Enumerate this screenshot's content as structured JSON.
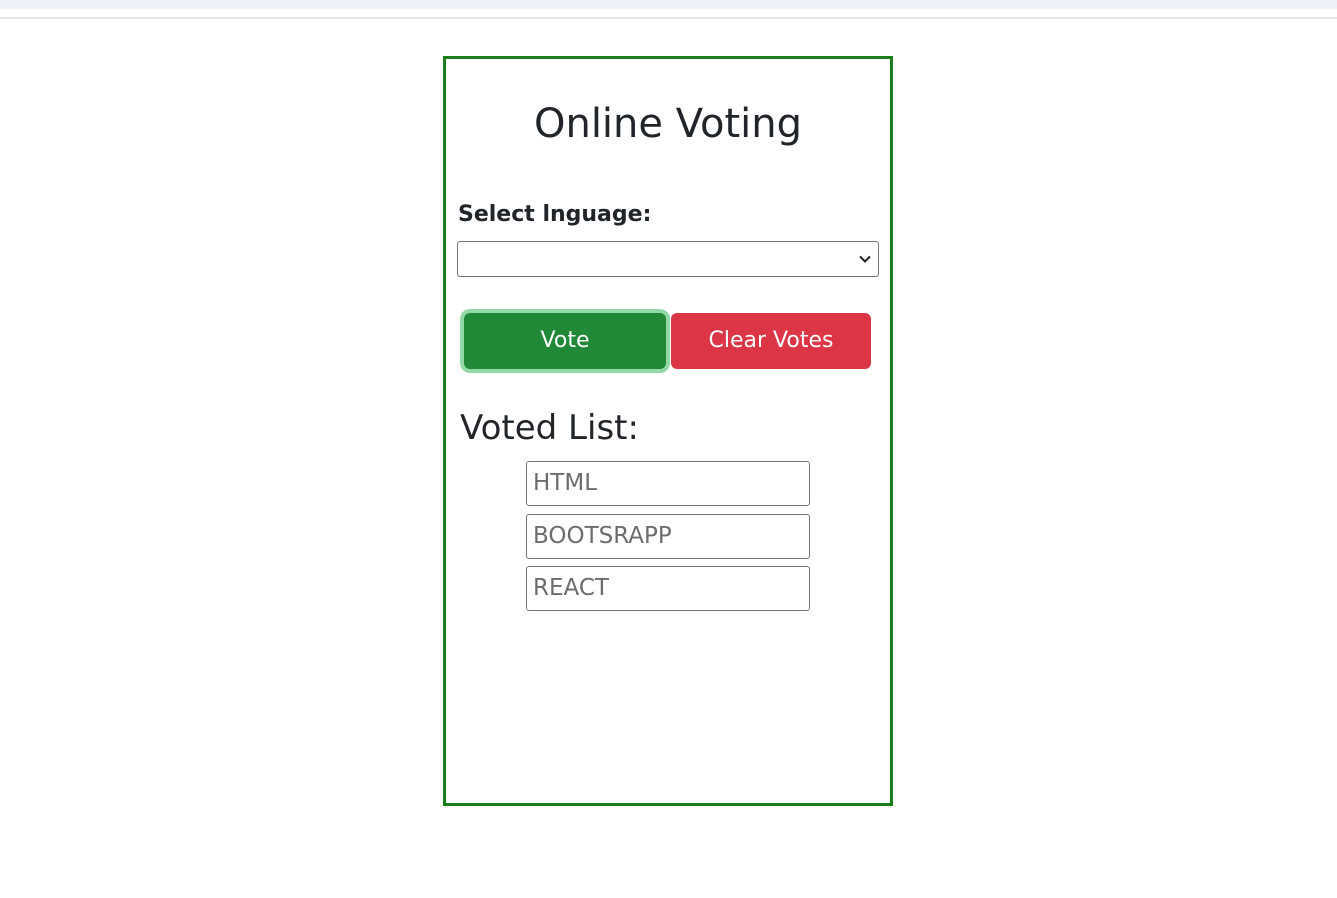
{
  "app": {
    "title": "Online Voting"
  },
  "form": {
    "select_label": "Select lnguage:",
    "selected_value": ""
  },
  "buttons": {
    "vote_label": "Vote",
    "clear_label": "Clear Votes"
  },
  "voted": {
    "heading": "Voted List:",
    "items": [
      "HTML",
      "BOOTSRAPP",
      "REACT"
    ]
  },
  "colors": {
    "card_border": "#1a7f1a",
    "vote_button": "#218838",
    "clear_button": "#dc3545"
  }
}
